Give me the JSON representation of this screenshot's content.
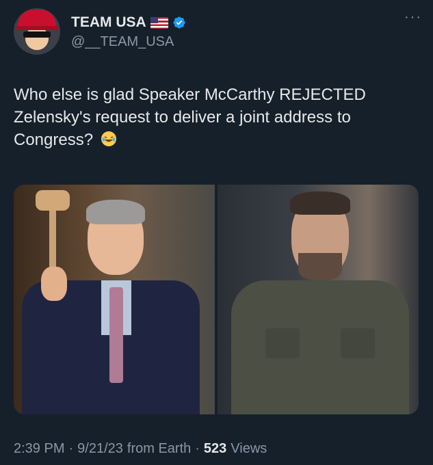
{
  "author": {
    "name": "TEAM USA",
    "flag_icon": "us-flag-icon",
    "verified_icon": "verified-badge-icon",
    "handle": "@__TEAM_USA",
    "avatar_icon": "avatar"
  },
  "menu": {
    "label": "···"
  },
  "tweet": {
    "text": "Who else is glad Speaker McCarthy REJECTED Zelensky's request to deliver a joint address to Congress?",
    "emoji_icon": "rolling-on-floor-laughing-emoji-icon"
  },
  "media": {
    "images": [
      {
        "name": "photo-left"
      },
      {
        "name": "photo-right"
      }
    ]
  },
  "footer": {
    "time": "2:39 PM",
    "sep1": "·",
    "date": "9/21/23",
    "source": "from Earth",
    "sep2": "·",
    "views_count": "523",
    "views_label": "Views"
  },
  "colors": {
    "background": "#15202b",
    "primary_text": "#e7e9ea",
    "secondary_text": "#8b98a5",
    "verified_blue": "#1d9bf0"
  }
}
